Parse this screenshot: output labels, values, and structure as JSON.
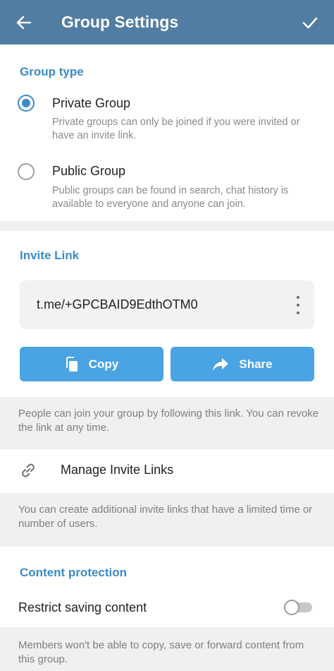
{
  "header": {
    "title": "Group Settings",
    "back_icon": "arrow-left-icon",
    "done_icon": "check-icon"
  },
  "group_type": {
    "section_title": "Group type",
    "selected": "private",
    "options": [
      {
        "title": "Private Group",
        "description": "Private groups can only be joined if you were invited or have an invite link."
      },
      {
        "title": "Public Group",
        "description": "Public groups can be found in search, chat history is available to everyone and anyone can join."
      }
    ]
  },
  "invite_link": {
    "section_title": "Invite Link",
    "link": "t.me/+GPCBAID9EdthOTM0",
    "copy_label": "Copy",
    "share_label": "Share",
    "note": "People can join your group by following this link. You can revoke the link at any time."
  },
  "manage_links": {
    "label": "Manage Invite Links",
    "note": "You can create additional invite links that have a limited time or number of users."
  },
  "content_protection": {
    "section_title": "Content protection",
    "toggle_label": "Restrict saving content",
    "enabled": false,
    "note": "Members won't be able to copy, save or forward content from this group."
  },
  "colors": {
    "appbar": "#517da2",
    "accent": "#3a8bc9",
    "button": "#4aa3e2"
  }
}
